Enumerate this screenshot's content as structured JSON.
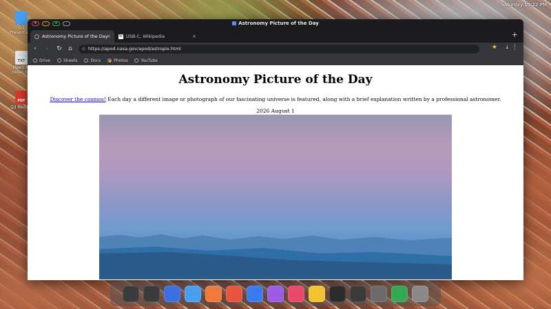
{
  "system": {
    "clock": "Saturday 10:22 PM"
  },
  "desktop_icons": [
    {
      "label": "Q3 Presentation",
      "badge": ""
    },
    {
      "label": "Meeting notes.txt",
      "badge": "TXT"
    },
    {
      "label": "Q3 Review",
      "badge": "PDF"
    }
  ],
  "window": {
    "title": "Astronomy Picture of the Day"
  },
  "tabs": [
    {
      "label": "Astronomy Picture of the Day",
      "active": true
    },
    {
      "label": "USB-C, Wikipedia",
      "active": false
    }
  ],
  "toolbar": {
    "url": "https://apod.nasa.gov/apod/astropix.html"
  },
  "bookmarks": [
    "Drive",
    "Sheets",
    "Docs",
    "Photos",
    "YouTube"
  ],
  "page": {
    "heading": "Astronomy Picture of the Day",
    "intro_link": "Discover the cosmos!",
    "intro_text": " Each day a different image or photograph of our fascinating universe is featured, along with a brief explanation written by a professional astronomer.",
    "date": "2026 August 1"
  },
  "dock": [
    {
      "name": "launchpad",
      "color": "#3b3b3b"
    },
    {
      "name": "finder-search",
      "color": "#3a3a3a"
    },
    {
      "name": "browser",
      "color": "#3d6fe0"
    },
    {
      "name": "files",
      "color": "#4a9ef0"
    },
    {
      "name": "photos-app",
      "color": "#f07a3c"
    },
    {
      "name": "presentation",
      "color": "#e8553e"
    },
    {
      "name": "documents",
      "color": "#3a7bf0"
    },
    {
      "name": "image-viewer",
      "color": "#9b5de5"
    },
    {
      "name": "media-player",
      "color": "#e84a6a"
    },
    {
      "name": "notes",
      "color": "#f2c230"
    },
    {
      "name": "calculator",
      "color": "#2c2c2c"
    },
    {
      "name": "camera",
      "color": "#3a3a3a"
    },
    {
      "name": "settings",
      "color": "#6b6b6b"
    },
    {
      "name": "help",
      "color": "#34a853"
    },
    {
      "name": "trash",
      "color": "#8a8a8a"
    }
  ]
}
